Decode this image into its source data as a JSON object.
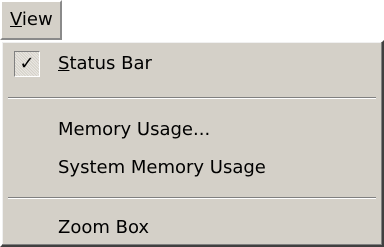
{
  "menubar": {
    "view_label": "View",
    "view_mnemonic": "V",
    "view_rest": "iew"
  },
  "menu": {
    "items": [
      {
        "label_mnemonic": "S",
        "label_rest": "tatus Bar",
        "checked": true,
        "check_glyph": "✓"
      },
      {
        "label": "Memory Usage..."
      },
      {
        "label": "System Memory Usage"
      },
      {
        "label": "Zoom Box"
      }
    ]
  },
  "colors": {
    "menu_face": "#d4d0c8",
    "shadow": "#808080",
    "highlight": "#ffffff"
  }
}
